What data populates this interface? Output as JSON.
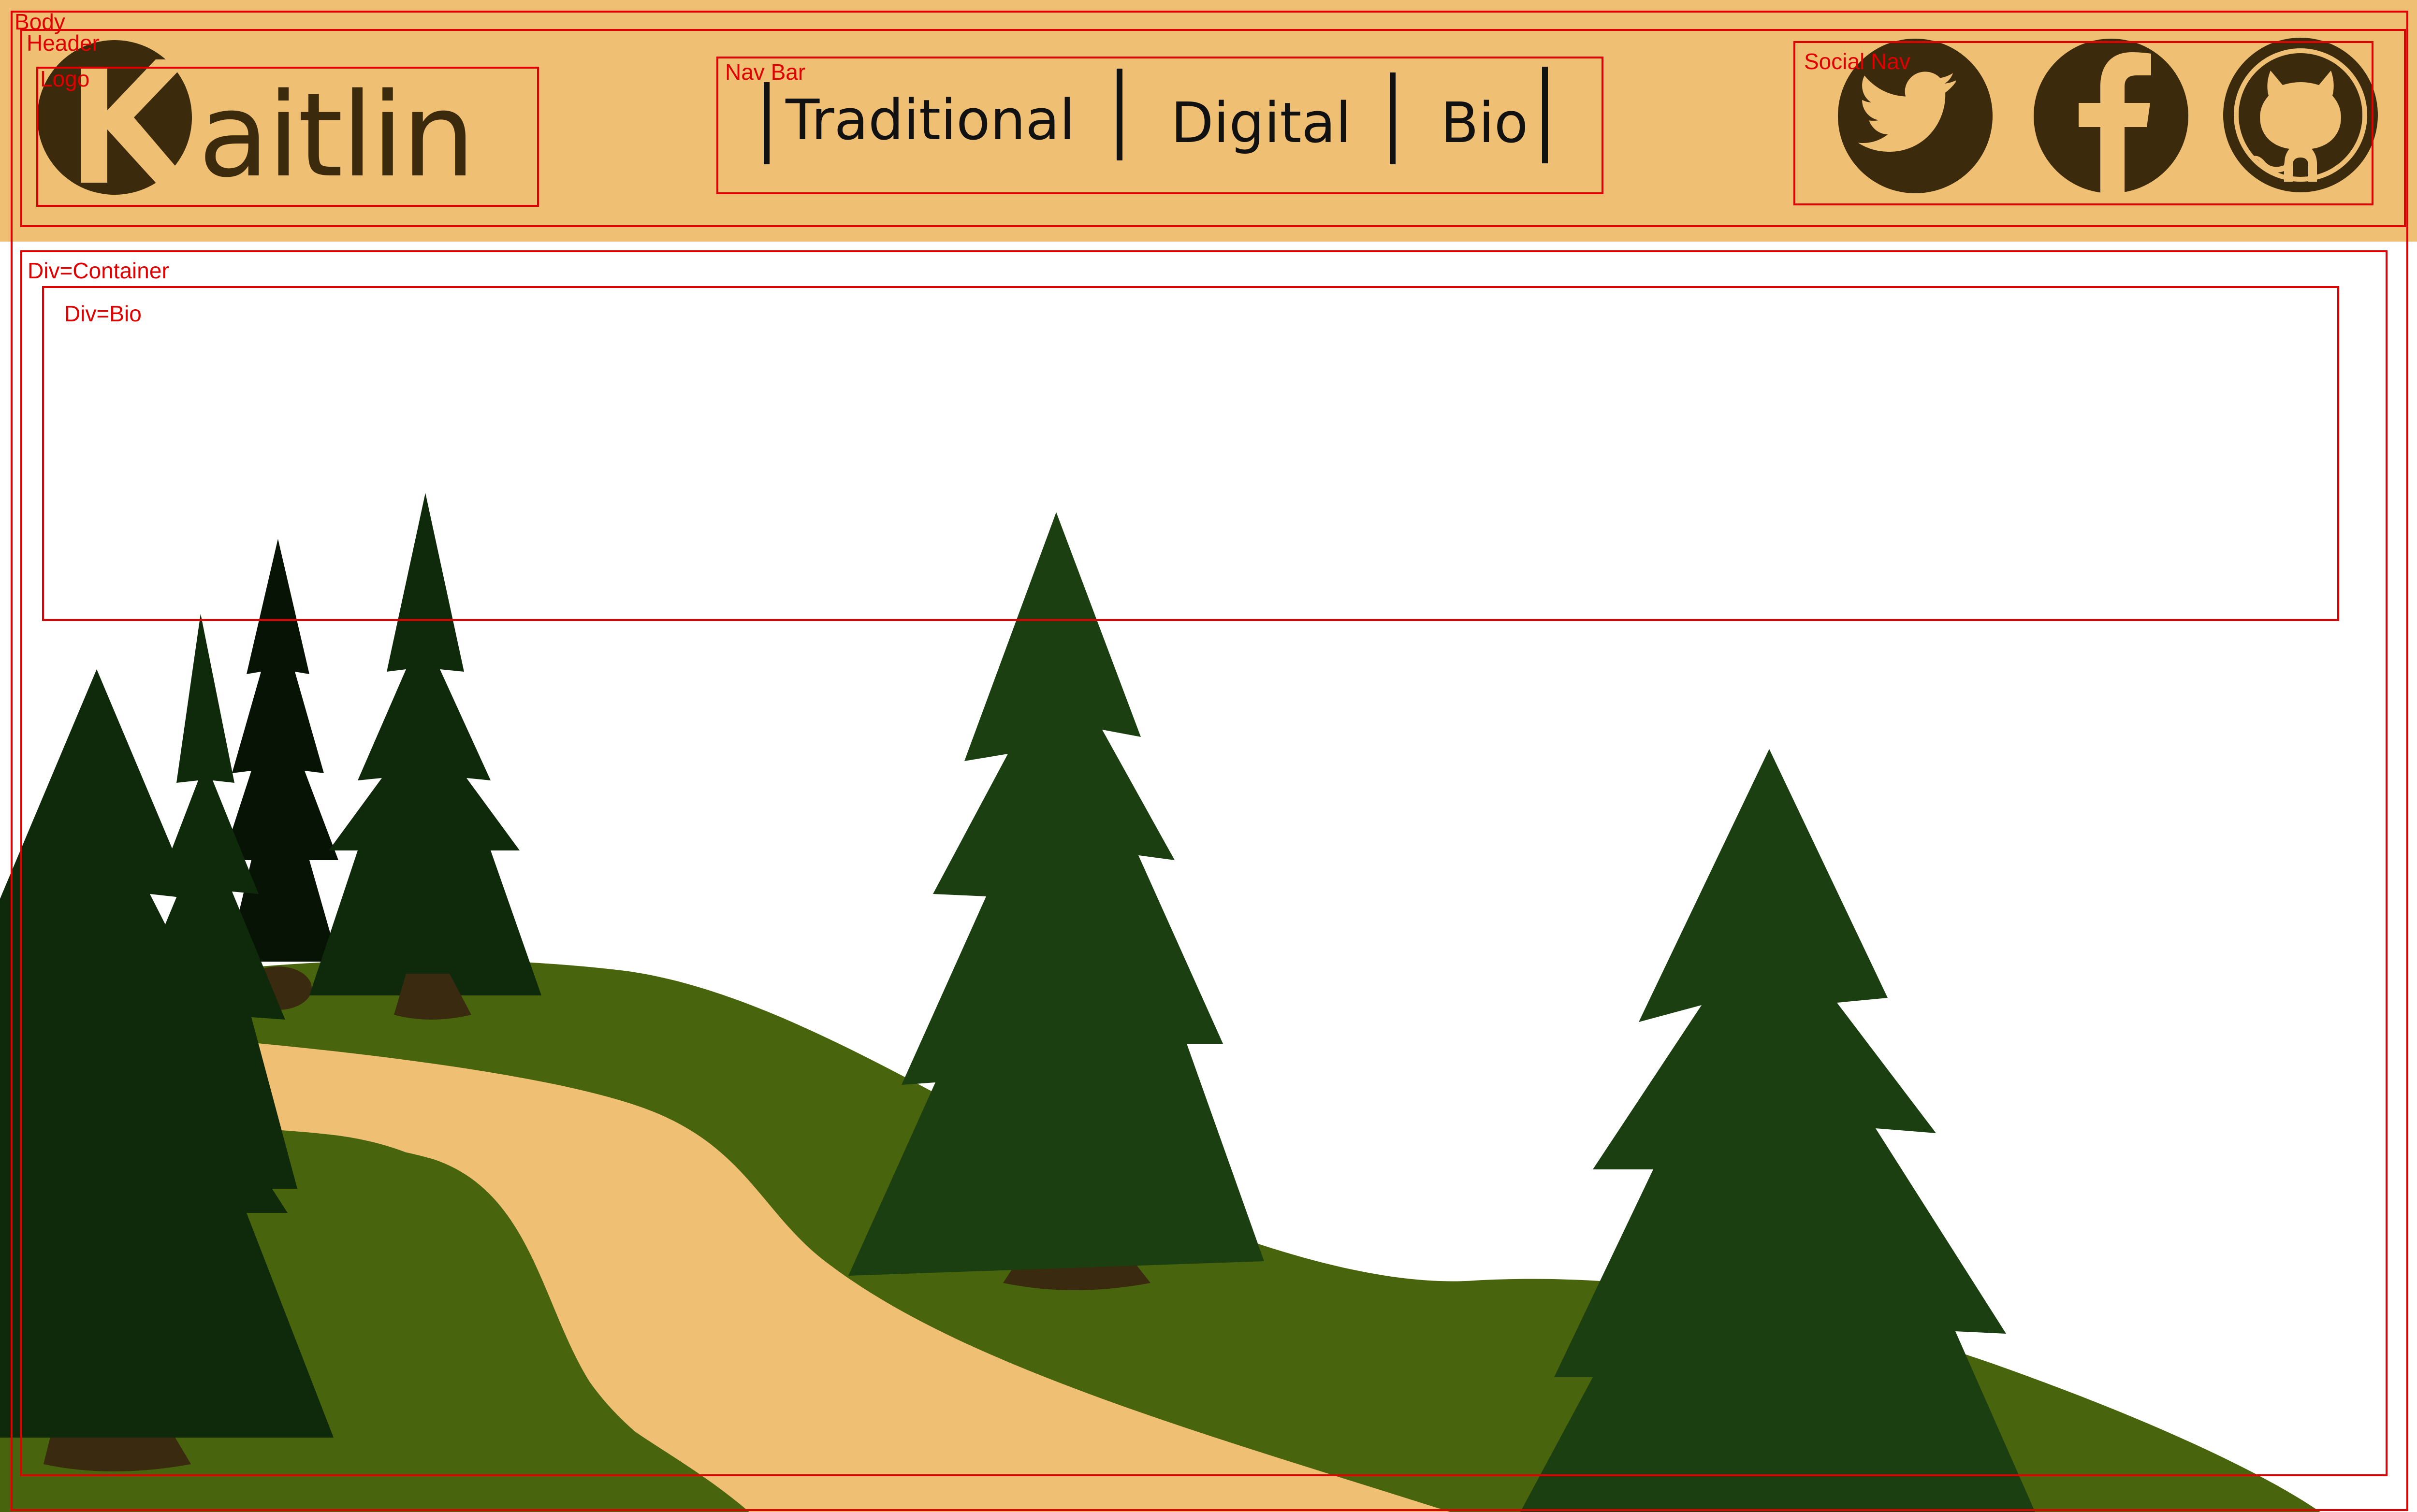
{
  "colors": {
    "header_bg": "#EFBF73",
    "logo_dark": "#3B2A0C",
    "wire_red": "#e00000",
    "grass": "#48650E",
    "path": "#EFBF73",
    "tree_dark": "#0F2A0A",
    "tree_mid": "#1B3F10",
    "trunk": "#3A2A10"
  },
  "wireframe_labels": {
    "body": "Body",
    "header": "Header",
    "logo": "Logo",
    "nav_bar": "Nav Bar",
    "social_nav": "Social Nav",
    "container": "Div=Container",
    "bio": "Div=Bio"
  },
  "logo": {
    "initial": "K",
    "rest": "aitlin"
  },
  "nav": {
    "items": [
      "Traditional",
      "Digital",
      "Bio"
    ]
  },
  "social": {
    "icons": [
      "twitter-icon",
      "facebook-icon",
      "github-icon"
    ]
  }
}
